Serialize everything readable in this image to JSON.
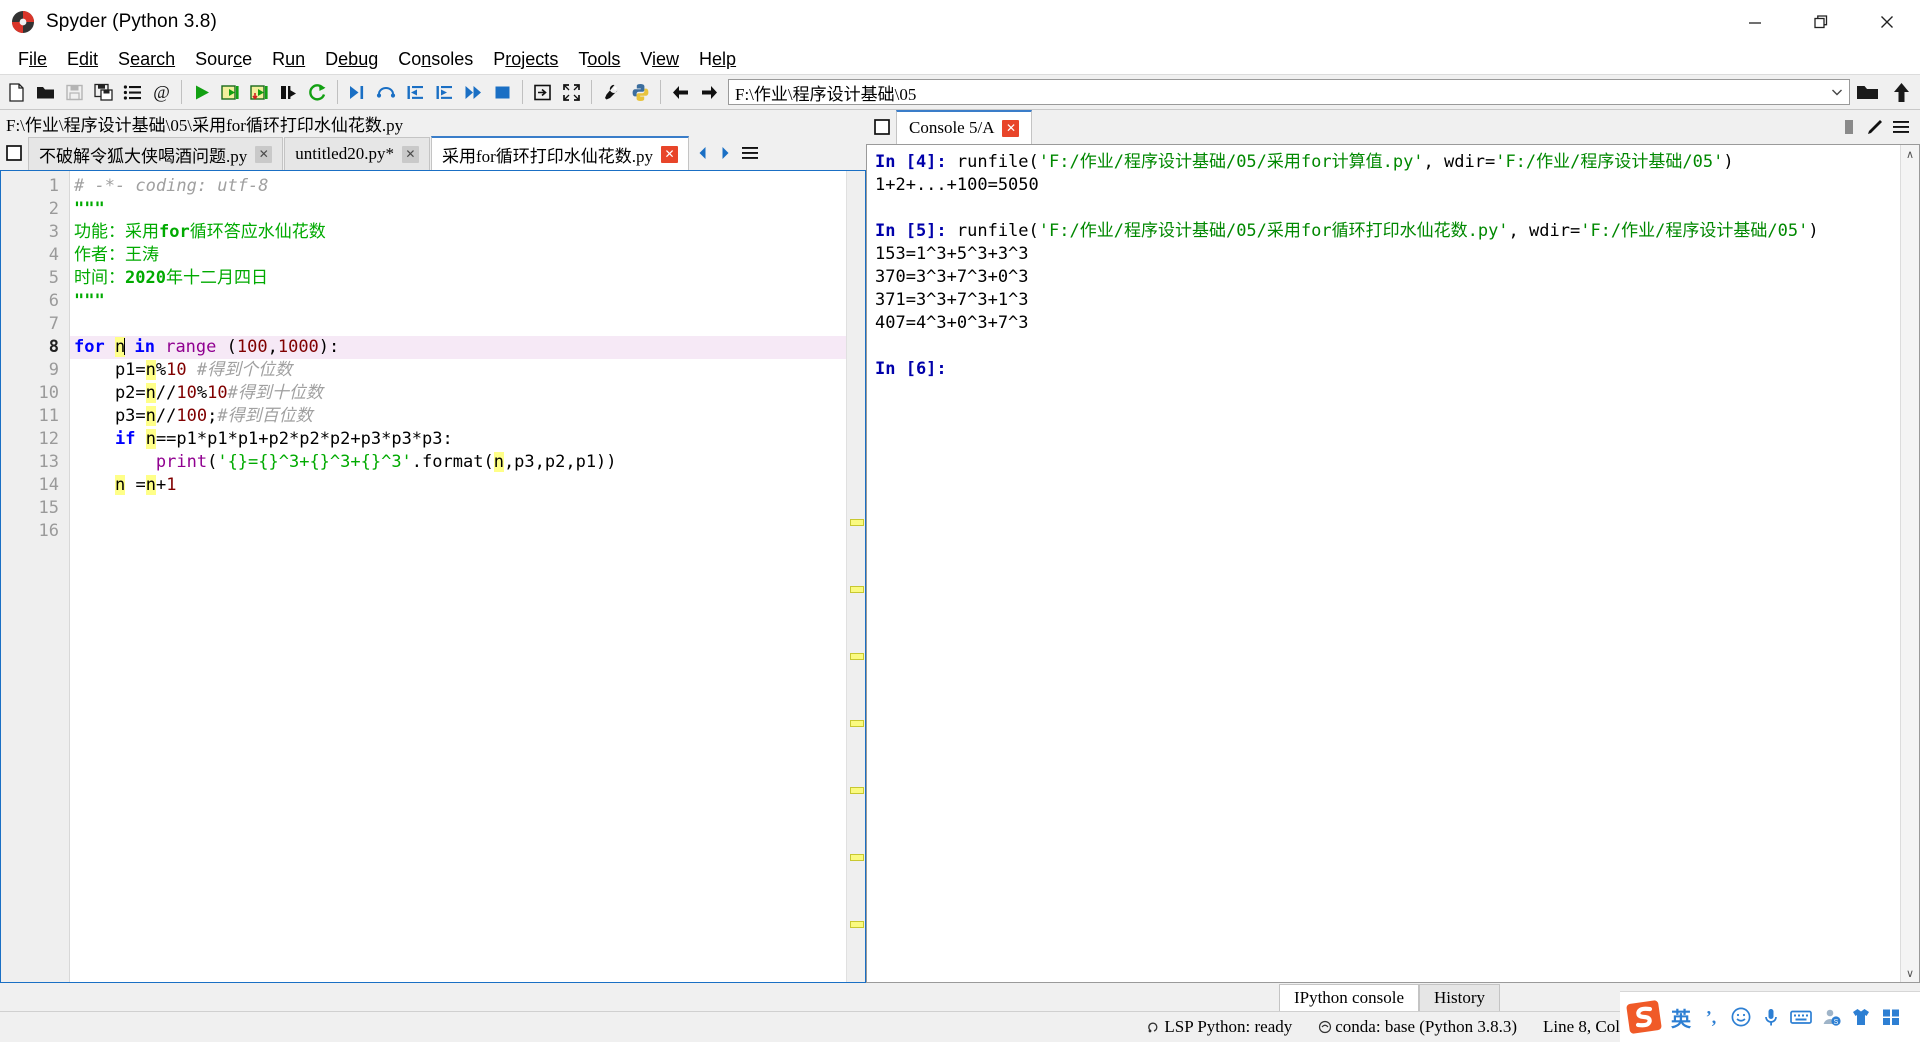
{
  "window": {
    "title": "Spyder (Python 3.8)",
    "app_icon": "spyder-icon",
    "minimize_label": "Minimize",
    "maximize_label": "Restore",
    "close_label": "Close"
  },
  "menubar": {
    "items": [
      {
        "name": "file",
        "pre": "F",
        "mid": "ile",
        "post": ""
      },
      {
        "name": "edit",
        "pre": "E",
        "mid": "dit",
        "post": ""
      },
      {
        "name": "search",
        "pre": "S",
        "mid": "earch",
        "post": ""
      },
      {
        "name": "source",
        "pre": "Sour",
        "mid": "c",
        "post": "e"
      },
      {
        "name": "run",
        "pre": "R",
        "mid": "un",
        "post": ""
      },
      {
        "name": "debug",
        "pre": "D",
        "mid": "ebug",
        "post": ""
      },
      {
        "name": "consoles",
        "pre": "Co",
        "mid": "n",
        "post": "soles"
      },
      {
        "name": "projects",
        "pre": "P",
        "mid": "rojects",
        "post": ""
      },
      {
        "name": "tools",
        "pre": "T",
        "mid": "ools",
        "post": ""
      },
      {
        "name": "view",
        "pre": "V",
        "mid": "iew",
        "post": ""
      },
      {
        "name": "help",
        "pre": "H",
        "mid": "elp",
        "post": ""
      }
    ]
  },
  "toolbar": {
    "icons": [
      "new-file-icon",
      "open-file-icon",
      "save-file-icon",
      "save-all-icon",
      "file-switcher-icon",
      "find-symbol-icon",
      "run-file-icon",
      "run-cell-icon",
      "run-cell-advance-icon",
      "run-selection-icon",
      "re-run-cell-icon",
      "debug-file-icon",
      "debug-step-over-icon",
      "debug-step-into-icon",
      "debug-step-return-icon",
      "debug-continue-icon",
      "debug-stop-icon",
      "maximize-pane-icon",
      "fullscreen-icon",
      "preferences-icon",
      "pythonpath-manager-icon",
      "back-icon",
      "forward-icon"
    ],
    "path_value": "F:\\作业\\程序设计基础\\05",
    "path_dropdown_icon": "chevron-down-icon",
    "browse_dir_icon": "open-folder-icon",
    "parent_dir_icon": "arrow-up-icon"
  },
  "editor": {
    "file_path_label": "F:\\作业\\程序设计基础\\05\\采用for循环打印水仙花数.py",
    "browse_tabs_icon": "browse-tabs-icon",
    "tabs": [
      {
        "label": "不破解令狐大侠喝酒问题.py",
        "active": false,
        "modified": false
      },
      {
        "label": "untitled20.py*",
        "active": false,
        "modified": true
      },
      {
        "label": "采用for循环打印水仙花数.py",
        "active": true,
        "modified": false
      }
    ],
    "close_glyph": "✕",
    "tab_prev_icon": "chevron-left-icon",
    "tab_next_icon": "chevron-right-icon",
    "options_icon": "hamburger-menu-icon",
    "line_count": 16,
    "current_line": 8,
    "lines": [
      {
        "n": 1,
        "tokens": [
          {
            "t": "# -*- coding: utf-8",
            "c": "cmt"
          }
        ]
      },
      {
        "n": 2,
        "tokens": [
          {
            "t": "\"\"\"",
            "c": "strb"
          }
        ]
      },
      {
        "n": 3,
        "tokens": [
          {
            "t": "功能：采用",
            "c": "str"
          },
          {
            "t": "for",
            "c": "strb"
          },
          {
            "t": "循环答应水仙花数",
            "c": "str"
          }
        ]
      },
      {
        "n": 4,
        "tokens": [
          {
            "t": "作者：王涛",
            "c": "str"
          }
        ]
      },
      {
        "n": 5,
        "tokens": [
          {
            "t": "时间：",
            "c": "str"
          },
          {
            "t": "2020",
            "c": "strb"
          },
          {
            "t": "年十二月四日",
            "c": "str"
          }
        ]
      },
      {
        "n": 6,
        "tokens": [
          {
            "t": "\"\"\"",
            "c": "strb"
          }
        ]
      },
      {
        "n": 7,
        "tokens": []
      },
      {
        "n": 8,
        "tokens": [
          {
            "t": "for",
            "c": "kw"
          },
          {
            "t": " ",
            "c": "plain"
          },
          {
            "t": "n",
            "c": "plain hl"
          },
          {
            "t": "CARET",
            "c": "caret"
          },
          {
            "t": " ",
            "c": "plain"
          },
          {
            "t": "in",
            "c": "kw"
          },
          {
            "t": " ",
            "c": "plain"
          },
          {
            "t": "range",
            "c": "bi"
          },
          {
            "t": " (",
            "c": "plain"
          },
          {
            "t": "100",
            "c": "num"
          },
          {
            "t": ",",
            "c": "plain"
          },
          {
            "t": "1000",
            "c": "num"
          },
          {
            "t": "):",
            "c": "plain"
          }
        ]
      },
      {
        "n": 9,
        "tokens": [
          {
            "t": "    p1=",
            "c": "plain"
          },
          {
            "t": "n",
            "c": "plain hl"
          },
          {
            "t": "%",
            "c": "plain"
          },
          {
            "t": "10",
            "c": "num"
          },
          {
            "t": " ",
            "c": "plain"
          },
          {
            "t": "#得到个位数",
            "c": "cmt"
          }
        ]
      },
      {
        "n": 10,
        "tokens": [
          {
            "t": "    p2=",
            "c": "plain"
          },
          {
            "t": "n",
            "c": "plain hl"
          },
          {
            "t": "//",
            "c": "plain"
          },
          {
            "t": "10",
            "c": "num"
          },
          {
            "t": "%",
            "c": "plain"
          },
          {
            "t": "10",
            "c": "num"
          },
          {
            "t": "#得到十位数",
            "c": "cmt"
          }
        ]
      },
      {
        "n": 11,
        "tokens": [
          {
            "t": "    p3=",
            "c": "plain"
          },
          {
            "t": "n",
            "c": "plain hl"
          },
          {
            "t": "//",
            "c": "plain"
          },
          {
            "t": "100",
            "c": "num"
          },
          {
            "t": ";",
            "c": "plain"
          },
          {
            "t": "#得到百位数",
            "c": "cmt"
          }
        ]
      },
      {
        "n": 12,
        "tokens": [
          {
            "t": "    ",
            "c": "plain"
          },
          {
            "t": "if",
            "c": "kw"
          },
          {
            "t": " ",
            "c": "plain"
          },
          {
            "t": "n",
            "c": "plain hl"
          },
          {
            "t": "==p1*p1*p1+p2*p2*p2+p3*p3*p3:",
            "c": "plain"
          }
        ]
      },
      {
        "n": 13,
        "tokens": [
          {
            "t": "        ",
            "c": "plain"
          },
          {
            "t": "print",
            "c": "bi"
          },
          {
            "t": "(",
            "c": "plain"
          },
          {
            "t": "'{}={}^3+{}^3+{}^3'",
            "c": "str"
          },
          {
            "t": ".format(",
            "c": "plain"
          },
          {
            "t": "n",
            "c": "plain hl"
          },
          {
            "t": ",p3,p2,p1))",
            "c": "plain"
          }
        ]
      },
      {
        "n": 14,
        "tokens": [
          {
            "t": "    ",
            "c": "plain"
          },
          {
            "t": "n",
            "c": "plain hl"
          },
          {
            "t": " =",
            "c": "plain"
          },
          {
            "t": "n",
            "c": "plain hl"
          },
          {
            "t": "+",
            "c": "plain"
          },
          {
            "t": "1",
            "c": "num"
          }
        ]
      },
      {
        "n": 15,
        "tokens": []
      },
      {
        "n": 16,
        "tokens": []
      }
    ],
    "occurrence_markers": [
      348,
      415,
      482,
      549,
      616,
      683,
      750
    ]
  },
  "console": {
    "tab_icon": "browse-tabs-icon",
    "tab_label": "Console 5/A",
    "close_glyph": "✕",
    "tools": [
      "maximize-pane-icon",
      "options-pencil-icon",
      "hamburger-menu-icon"
    ],
    "scroll_up_glyph": "∧",
    "scroll_down_glyph": "∨",
    "entries": [
      {
        "type": "input",
        "prompt": "In [4]: ",
        "parts": [
          {
            "t": "runfile(",
            "c": "cfn"
          },
          {
            "t": "'F:/作业/程序设计基础/05/采用for计算值.py'",
            "c": "cstr"
          },
          {
            "t": ", wdir=",
            "c": "cfn"
          },
          {
            "t": "'F:/作业/程序设计基础/05'",
            "c": "cstr"
          },
          {
            "t": ")",
            "c": "cfn"
          }
        ]
      },
      {
        "type": "output",
        "text": "1+2+...+100=5050"
      },
      {
        "type": "blank",
        "text": ""
      },
      {
        "type": "input",
        "prompt": "In [5]: ",
        "parts": [
          {
            "t": "runfile(",
            "c": "cfn"
          },
          {
            "t": "'F:/作业/程序设计基础/05/采用for循环打印水仙花数.py'",
            "c": "cstr"
          },
          {
            "t": ", wdir=",
            "c": "cfn"
          },
          {
            "t": "'F:/作业/程序设计基础/05'",
            "c": "cstr"
          },
          {
            "t": ")",
            "c": "cfn"
          }
        ]
      },
      {
        "type": "output",
        "text": "153=1^3+5^3+3^3"
      },
      {
        "type": "output",
        "text": "370=3^3+7^3+0^3"
      },
      {
        "type": "output",
        "text": "371=3^3+7^3+1^3"
      },
      {
        "type": "output",
        "text": "407=4^3+0^3+7^3"
      },
      {
        "type": "blank",
        "text": ""
      },
      {
        "type": "input",
        "prompt": "In [6]: ",
        "parts": []
      }
    ]
  },
  "bottom_tabs": [
    {
      "label": "IPython console",
      "active": true
    },
    {
      "label": "History",
      "active": false
    }
  ],
  "statusbar": {
    "lsp_icon": "lsp-status-icon",
    "lsp_text": "LSP Python: ready",
    "conda_icon": "conda-icon",
    "conda_text": "conda: base (Python 3.8.3)",
    "cursor_text": "Line 8, Col"
  },
  "ime": {
    "logo": "sogou-logo-icon",
    "icons": [
      "language-mode-icon",
      "punctuation-mode-icon",
      "emoji-icon",
      "voice-input-icon",
      "soft-keyboard-icon",
      "user-account-icon",
      "skin-icon",
      "toolbox-icon"
    ],
    "language_glyph": "英",
    "punct_glyph": "’,"
  },
  "colors": {
    "accent": "#1a6fc4",
    "tab_active_border": "#3a7dc9",
    "current_line": "#f6e9f6",
    "highlight": "#ffff88",
    "string_green": "#00aa00",
    "keyword_blue": "#0000ff",
    "builtin_purple": "#900090",
    "number_maroon": "#800000",
    "comment_gray": "#a0a0a0",
    "ime_blue": "#2d7fd3",
    "ime_orange": "#f05a28"
  }
}
